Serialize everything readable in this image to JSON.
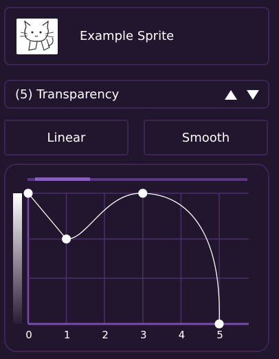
{
  "sprite": {
    "name": "Example Sprite"
  },
  "property": {
    "label": "(5) Transparency"
  },
  "buttons": {
    "linear": "Linear",
    "smooth": "Smooth"
  },
  "chart_data": {
    "type": "line",
    "x": [
      0,
      1,
      3,
      5
    ],
    "y": [
      1.0,
      0.65,
      1.0,
      0.0
    ],
    "xticks": [
      "0",
      "1",
      "2",
      "3",
      "4",
      "5"
    ],
    "xlim": [
      0,
      5
    ],
    "ylim": [
      0,
      1
    ],
    "interpolation": "smooth",
    "line_color": "#ffffff",
    "grid_color": "#4a2f6a",
    "axis_color": "#7a48b0",
    "scroll_position": 0.23
  }
}
